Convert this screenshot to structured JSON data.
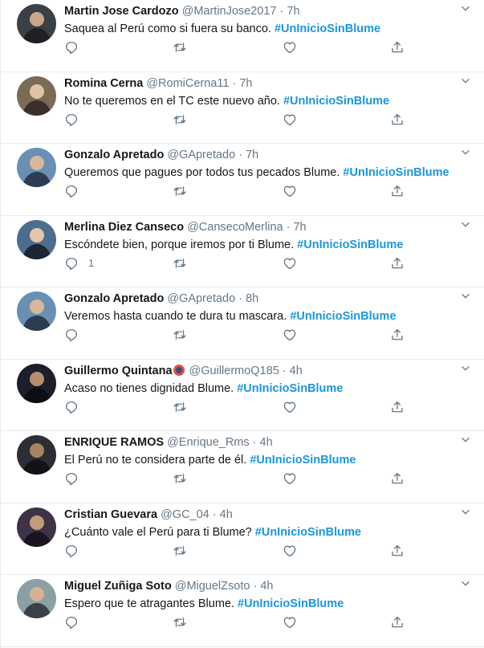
{
  "colors": {
    "accent": "#1b95e0",
    "muted": "#657786",
    "divider": "#e6ecf0"
  },
  "icons": {
    "reply": "reply-icon",
    "retweet": "retweet-icon",
    "like": "heart-icon",
    "share": "share-icon",
    "more": "chevron-down-icon"
  },
  "tweets": [
    {
      "name": "Martin Jose Cardozo",
      "handle": "@MartinJose2017",
      "time": "7h",
      "text": "Saquea al Perú como si fuera su banco.",
      "hashtag": "#UnInicioSinBlume",
      "reply_count": ""
    },
    {
      "name": "Romina Cerna",
      "handle": "@RomiCerna11",
      "time": "7h",
      "text": "No te queremos en el TC este nuevo año.",
      "hashtag": "#UnInicioSinBlume",
      "reply_count": ""
    },
    {
      "name": "Gonzalo Apretado",
      "handle": "@GApretado",
      "time": "7h",
      "text": "Queremos que pagues por todos tus pecados Blume.",
      "hashtag": "#UnInicioSinBlume",
      "reply_count": ""
    },
    {
      "name": "Merlina Diez Canseco",
      "handle": "@CansecoMerlina",
      "time": "7h",
      "text": "Escóndete bien, porque iremos por ti Blume.",
      "hashtag": "#UnInicioSinBlume",
      "reply_count": "1"
    },
    {
      "name": "Gonzalo Apretado",
      "handle": "@GApretado",
      "time": "8h",
      "text": "Veremos hasta cuando te dura tu mascara.",
      "hashtag": "#UnInicioSinBlume",
      "reply_count": ""
    },
    {
      "name": "Guillermo Quintana",
      "handle": "@GuillermoQ185",
      "time": "4h",
      "text": "Acaso no tienes dignidad Blume.",
      "hashtag": "#UnInicioSinBlume",
      "reply_count": "",
      "emoji": true
    },
    {
      "name": "ENRIQUE RAMOS",
      "handle": "@Enrique_Rms",
      "time": "4h",
      "text": "El Perú no te considera parte de él.",
      "hashtag": "#UnInicioSinBlume",
      "reply_count": ""
    },
    {
      "name": "Cristian Guevara",
      "handle": "@GC_04",
      "time": "4h",
      "text": "¿Cuánto vale el Perú para ti Blume?",
      "hashtag": "#UnInicioSinBlume",
      "reply_count": ""
    },
    {
      "name": "Miguel Zuñiga Soto",
      "handle": "@MiguelZsoto",
      "time": "4h",
      "text": "Espero que te atragantes Blume.",
      "hashtag": "#UnInicioSinBlume",
      "reply_count": ""
    }
  ]
}
